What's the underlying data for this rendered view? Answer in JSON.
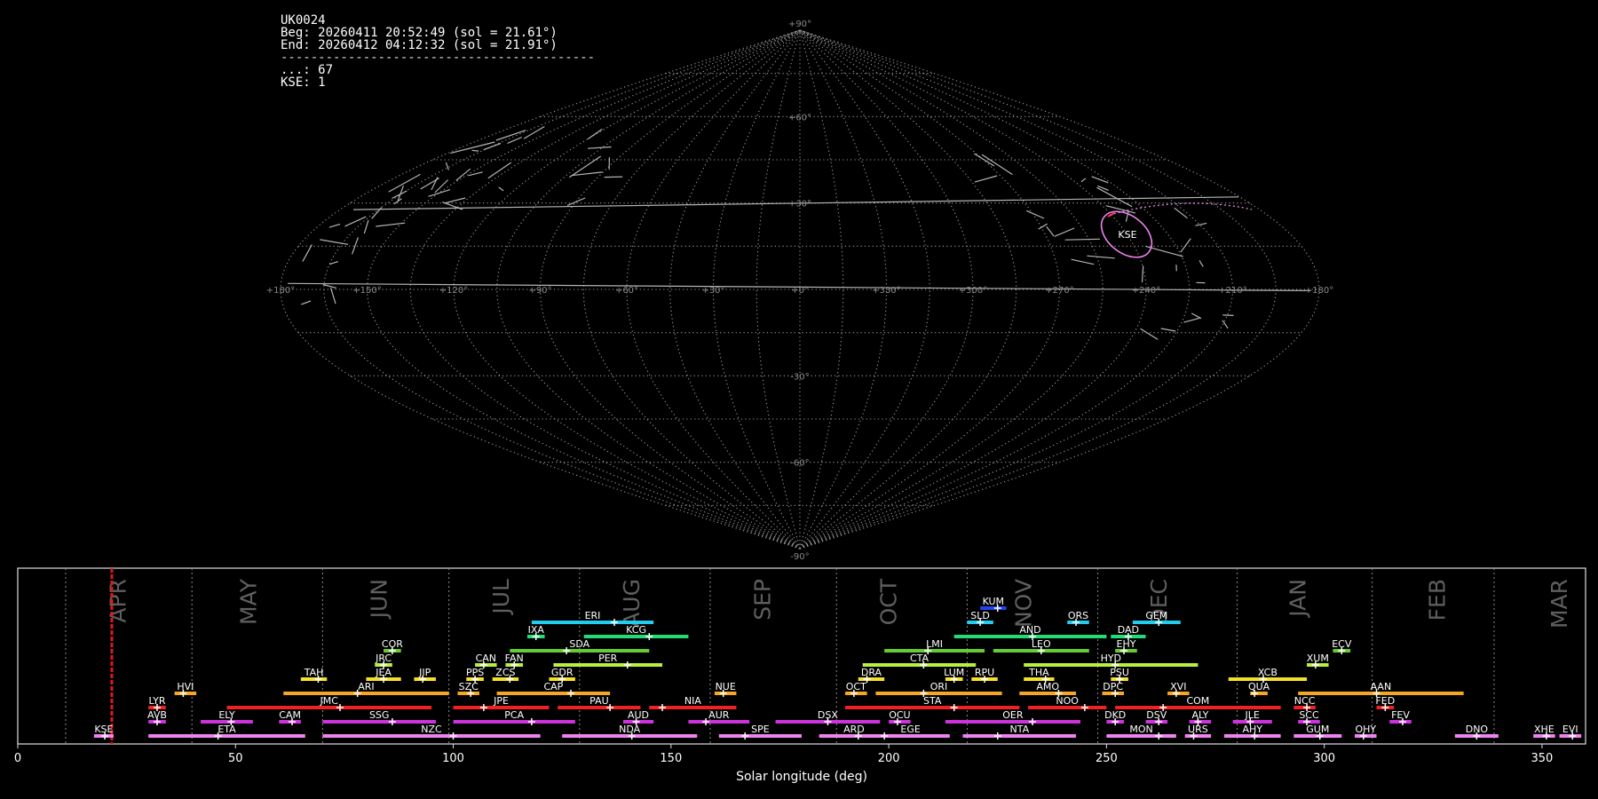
{
  "header": {
    "station": "UK0024",
    "beg": "Beg: 20260411 20:52:49 (sol = 21.61°)",
    "end": "End: 20260412 04:12:32 (sol = 21.91°)",
    "separator": "------------------------------------------",
    "counts": [
      {
        "code": "...",
        "value": "67",
        "text": "...: 67"
      },
      {
        "code": "KSE",
        "value": "1",
        "text": "KSE: 1"
      }
    ]
  },
  "sky_map": {
    "projection": "sinusoidal",
    "lon_labels": [
      "+180°",
      "+150°",
      "+120°",
      "+90°",
      "+60°",
      "+30°",
      "+0°",
      "+330°",
      "+300°",
      "+270°",
      "+240°",
      "+210°",
      "+180°"
    ],
    "lat_labels": [
      "+90°",
      "+60°",
      "+30°",
      "-30°",
      "-60°",
      "-90°"
    ],
    "kse_label": "KSE",
    "kse_color": "#ee82ee"
  },
  "chart_data": {
    "type": "timeline",
    "xlabel": "Solar longitude (deg)",
    "xlim": [
      0,
      360
    ],
    "xticks": [
      "0",
      "50",
      "100",
      "150",
      "200",
      "250",
      "300",
      "350"
    ],
    "months": [
      {
        "label": "APR",
        "sol": 23
      },
      {
        "label": "MAY",
        "sol": 53
      },
      {
        "label": "JUN",
        "sol": 83
      },
      {
        "label": "JUL",
        "sol": 111
      },
      {
        "label": "AUG",
        "sol": 141
      },
      {
        "label": "SEP",
        "sol": 171
      },
      {
        "label": "OCT",
        "sol": 200
      },
      {
        "label": "NOV",
        "sol": 231
      },
      {
        "label": "DEC",
        "sol": 262
      },
      {
        "label": "JAN",
        "sol": 294
      },
      {
        "label": "FEB",
        "sol": 326
      },
      {
        "label": "MAR",
        "sol": 354
      }
    ],
    "month_boundaries": [
      11,
      40,
      70,
      99,
      129,
      159,
      188,
      218,
      248,
      280,
      311,
      339
    ],
    "current_sol": 21.6,
    "showers": [
      {
        "code": "KSE",
        "start": 17.5,
        "end": 22,
        "peak": 20,
        "row": 0,
        "color": "#ee82ee"
      },
      {
        "code": "ETA",
        "start": 30,
        "end": 66,
        "peak": 46,
        "row": 0,
        "color": "#ee82ee"
      },
      {
        "code": "NZC",
        "start": 70,
        "end": 120,
        "peak": 100,
        "row": 0,
        "color": "#ee82ee"
      },
      {
        "code": "NDA",
        "start": 125,
        "end": 156,
        "peak": 141,
        "row": 0,
        "color": "#ee82ee"
      },
      {
        "code": "SPE",
        "start": 161,
        "end": 180,
        "peak": 167,
        "row": 0,
        "color": "#ee82ee"
      },
      {
        "code": "ARD",
        "start": 184,
        "end": 200,
        "peak": 193,
        "row": 0,
        "color": "#ee82ee"
      },
      {
        "code": "EGE",
        "start": 196,
        "end": 214,
        "peak": 199,
        "row": 0,
        "color": "#ee82ee"
      },
      {
        "code": "NTA",
        "start": 217,
        "end": 243,
        "peak": 225,
        "row": 0,
        "color": "#ee82ee"
      },
      {
        "code": "MON",
        "start": 250,
        "end": 266,
        "peak": 262,
        "row": 0,
        "color": "#ee82ee"
      },
      {
        "code": "URS",
        "start": 268,
        "end": 274,
        "peak": 270,
        "row": 0,
        "color": "#ee82ee"
      },
      {
        "code": "AHY",
        "start": 277,
        "end": 290,
        "peak": 284,
        "row": 0,
        "color": "#ee82ee"
      },
      {
        "code": "GUM",
        "start": 293,
        "end": 304,
        "peak": 299,
        "row": 0,
        "color": "#ee82ee"
      },
      {
        "code": "OHY",
        "start": 307,
        "end": 312,
        "peak": 309,
        "row": 0,
        "color": "#ee82ee"
      },
      {
        "code": "DNO",
        "start": 330,
        "end": 340,
        "peak": 335,
        "row": 0,
        "color": "#ee82ee"
      },
      {
        "code": "XHE",
        "start": 348,
        "end": 353,
        "peak": 351,
        "row": 0,
        "color": "#ee82ee"
      },
      {
        "code": "EVI",
        "start": 354,
        "end": 359,
        "peak": 357,
        "row": 0,
        "color": "#ee82ee"
      },
      {
        "code": "AVB",
        "start": 30,
        "end": 34,
        "peak": 32,
        "row": 1,
        "color": "#cc33dd"
      },
      {
        "code": "ELY",
        "start": 42,
        "end": 54,
        "peak": 49,
        "row": 1,
        "color": "#cc33dd"
      },
      {
        "code": "CAM",
        "start": 60,
        "end": 65,
        "peak": 63,
        "row": 1,
        "color": "#cc33dd"
      },
      {
        "code": "SSG",
        "start": 70,
        "end": 96,
        "peak": 86,
        "row": 1,
        "color": "#cc33dd"
      },
      {
        "code": "PCA",
        "start": 100,
        "end": 128,
        "peak": 118,
        "row": 1,
        "color": "#cc33dd"
      },
      {
        "code": "AUD",
        "start": 139,
        "end": 146,
        "peak": 142,
        "row": 1,
        "color": "#cc33dd"
      },
      {
        "code": "AUR",
        "start": 154,
        "end": 168,
        "peak": 158,
        "row": 1,
        "color": "#cc33dd"
      },
      {
        "code": "DSX",
        "start": 174,
        "end": 198,
        "peak": 186,
        "row": 1,
        "color": "#cc33dd"
      },
      {
        "code": "OCU",
        "start": 200,
        "end": 205,
        "peak": 202,
        "row": 1,
        "color": "#cc33dd"
      },
      {
        "code": "OER",
        "start": 213,
        "end": 244,
        "peak": 233,
        "row": 1,
        "color": "#cc33dd"
      },
      {
        "code": "DKD",
        "start": 250,
        "end": 254,
        "peak": 252,
        "row": 1,
        "color": "#cc33dd"
      },
      {
        "code": "DSV",
        "start": 259,
        "end": 264,
        "peak": 262,
        "row": 1,
        "color": "#cc33dd"
      },
      {
        "code": "ALY",
        "start": 269,
        "end": 274,
        "peak": 271,
        "row": 1,
        "color": "#cc33dd"
      },
      {
        "code": "JLE",
        "start": 279,
        "end": 288,
        "peak": 283,
        "row": 1,
        "color": "#cc33dd"
      },
      {
        "code": "SCC",
        "start": 294,
        "end": 299,
        "peak": 296,
        "row": 1,
        "color": "#cc33dd"
      },
      {
        "code": "FEV",
        "start": 315,
        "end": 320,
        "peak": 318,
        "row": 1,
        "color": "#cc33dd"
      },
      {
        "code": "LYR",
        "start": 30,
        "end": 34,
        "peak": 32,
        "row": 2,
        "color": "#ee2222"
      },
      {
        "code": "JMC",
        "start": 48,
        "end": 95,
        "peak": 74,
        "row": 2,
        "color": "#ee2222"
      },
      {
        "code": "JPE",
        "start": 100,
        "end": 122,
        "peak": 107,
        "row": 2,
        "color": "#ee2222"
      },
      {
        "code": "PAU",
        "start": 124,
        "end": 143,
        "peak": 136,
        "row": 2,
        "color": "#ee2222"
      },
      {
        "code": "NIA",
        "start": 145,
        "end": 165,
        "peak": 148,
        "row": 2,
        "color": "#ee2222"
      },
      {
        "code": "STA",
        "start": 190,
        "end": 230,
        "peak": 215,
        "row": 2,
        "color": "#ee2222"
      },
      {
        "code": "NOO",
        "start": 232,
        "end": 250,
        "peak": 245,
        "row": 2,
        "color": "#ee2222"
      },
      {
        "code": "COM",
        "start": 252,
        "end": 290,
        "peak": 263,
        "row": 2,
        "color": "#ee2222"
      },
      {
        "code": "NCC",
        "start": 293,
        "end": 298,
        "peak": 296,
        "row": 2,
        "color": "#ee2222"
      },
      {
        "code": "FED",
        "start": 312,
        "end": 316,
        "peak": 314,
        "row": 2,
        "color": "#ee2222"
      },
      {
        "code": "HVI",
        "start": 36,
        "end": 41,
        "peak": 38,
        "row": 3,
        "color": "#f5a623"
      },
      {
        "code": "ARI",
        "start": 61,
        "end": 99,
        "peak": 78,
        "row": 3,
        "color": "#f5a623"
      },
      {
        "code": "SZC",
        "start": 101,
        "end": 106,
        "peak": 104,
        "row": 3,
        "color": "#f5a623"
      },
      {
        "code": "CAP",
        "start": 110,
        "end": 136,
        "peak": 127,
        "row": 3,
        "color": "#f5a623"
      },
      {
        "code": "NUE",
        "start": 160,
        "end": 165,
        "peak": 162,
        "row": 3,
        "color": "#f5a623"
      },
      {
        "code": "OCT",
        "start": 190,
        "end": 195,
        "peak": 192,
        "row": 3,
        "color": "#f5a623"
      },
      {
        "code": "ORI",
        "start": 197,
        "end": 226,
        "peak": 208,
        "row": 3,
        "color": "#f5a623"
      },
      {
        "code": "AMO",
        "start": 230,
        "end": 243,
        "peak": 239,
        "row": 3,
        "color": "#f5a623"
      },
      {
        "code": "DPC",
        "start": 249,
        "end": 254,
        "peak": 252,
        "row": 3,
        "color": "#f5a623"
      },
      {
        "code": "XVI",
        "start": 264,
        "end": 269,
        "peak": 266,
        "row": 3,
        "color": "#f5a623"
      },
      {
        "code": "QUA",
        "start": 283,
        "end": 287,
        "peak": 284,
        "row": 3,
        "color": "#f5a623"
      },
      {
        "code": "AAN",
        "start": 294,
        "end": 332,
        "peak": 312,
        "row": 3,
        "color": "#f5a623"
      },
      {
        "code": "TAH",
        "start": 65,
        "end": 71,
        "peak": 69,
        "row": 4,
        "color": "#f5e028"
      },
      {
        "code": "JEA",
        "start": 80,
        "end": 88,
        "peak": 84,
        "row": 4,
        "color": "#f5e028"
      },
      {
        "code": "JIP",
        "start": 91,
        "end": 96,
        "peak": 93,
        "row": 4,
        "color": "#f5e028"
      },
      {
        "code": "PPS",
        "start": 103,
        "end": 107,
        "peak": 105,
        "row": 4,
        "color": "#f5e028"
      },
      {
        "code": "ZCS",
        "start": 109,
        "end": 115,
        "peak": 113,
        "row": 4,
        "color": "#f5e028"
      },
      {
        "code": "GDR",
        "start": 122,
        "end": 128,
        "peak": 125,
        "row": 4,
        "color": "#f5e028"
      },
      {
        "code": "DRA",
        "start": 193,
        "end": 199,
        "peak": 195,
        "row": 4,
        "color": "#f5e028"
      },
      {
        "code": "LUM",
        "start": 213,
        "end": 217,
        "peak": 215,
        "row": 4,
        "color": "#f5e028"
      },
      {
        "code": "RPU",
        "start": 219,
        "end": 225,
        "peak": 222,
        "row": 4,
        "color": "#f5e028"
      },
      {
        "code": "THA",
        "start": 231,
        "end": 238,
        "peak": 236,
        "row": 4,
        "color": "#f5e028"
      },
      {
        "code": "PSU",
        "start": 251,
        "end": 255,
        "peak": 253,
        "row": 4,
        "color": "#f5e028"
      },
      {
        "code": "XCB",
        "start": 278,
        "end": 296,
        "peak": 286,
        "row": 4,
        "color": "#f5e028"
      },
      {
        "code": "JRC",
        "start": 82,
        "end": 86,
        "peak": 84,
        "row": 5,
        "color": "#b8f040"
      },
      {
        "code": "CAN",
        "start": 105,
        "end": 110,
        "peak": 107,
        "row": 5,
        "color": "#b8f040"
      },
      {
        "code": "FAN",
        "start": 112,
        "end": 116,
        "peak": 114,
        "row": 5,
        "color": "#b8f040"
      },
      {
        "code": "PER",
        "start": 123,
        "end": 148,
        "peak": 140,
        "row": 5,
        "color": "#b8f040"
      },
      {
        "code": "CTA",
        "start": 194,
        "end": 220,
        "peak": 208,
        "row": 5,
        "color": "#b8f040"
      },
      {
        "code": "HYD",
        "start": 231,
        "end": 271,
        "peak": 252,
        "row": 5,
        "color": "#b8f040"
      },
      {
        "code": "XUM",
        "start": 296,
        "end": 301,
        "peak": 298,
        "row": 5,
        "color": "#b8f040"
      },
      {
        "code": "COR",
        "start": 84,
        "end": 88,
        "peak": 86,
        "row": 6,
        "color": "#66cc33"
      },
      {
        "code": "SDA",
        "start": 113,
        "end": 145,
        "peak": 126,
        "row": 6,
        "color": "#66cc33"
      },
      {
        "code": "LMI",
        "start": 199,
        "end": 222,
        "peak": 209,
        "row": 6,
        "color": "#66cc33"
      },
      {
        "code": "LEO",
        "start": 224,
        "end": 246,
        "peak": 235,
        "row": 6,
        "color": "#66cc33"
      },
      {
        "code": "EHY",
        "start": 252,
        "end": 257,
        "peak": 254,
        "row": 6,
        "color": "#66cc33"
      },
      {
        "code": "ECV",
        "start": 302,
        "end": 306,
        "peak": 304,
        "row": 6,
        "color": "#66cc33"
      },
      {
        "code": "IXA",
        "start": 117,
        "end": 121,
        "peak": 119,
        "row": 7,
        "color": "#22dd77"
      },
      {
        "code": "KCG",
        "start": 130,
        "end": 154,
        "peak": 145,
        "row": 7,
        "color": "#22dd77"
      },
      {
        "code": "AND",
        "start": 215,
        "end": 250,
        "peak": 233,
        "row": 7,
        "color": "#22dd77"
      },
      {
        "code": "DAD",
        "start": 251,
        "end": 259,
        "peak": 255,
        "row": 7,
        "color": "#22dd77"
      },
      {
        "code": "ERI",
        "start": 118,
        "end": 146,
        "peak": 137,
        "row": 8,
        "color": "#22ccee"
      },
      {
        "code": "SLD",
        "start": 218,
        "end": 224,
        "peak": 221,
        "row": 8,
        "color": "#22ccee"
      },
      {
        "code": "ORS",
        "start": 241,
        "end": 246,
        "peak": 243,
        "row": 8,
        "color": "#22ccee"
      },
      {
        "code": "GEM",
        "start": 256,
        "end": 267,
        "peak": 262,
        "row": 8,
        "color": "#22ccee"
      },
      {
        "code": "KUM",
        "start": 221,
        "end": 227,
        "peak": 225,
        "row": 9,
        "color": "#2244ee"
      }
    ]
  }
}
